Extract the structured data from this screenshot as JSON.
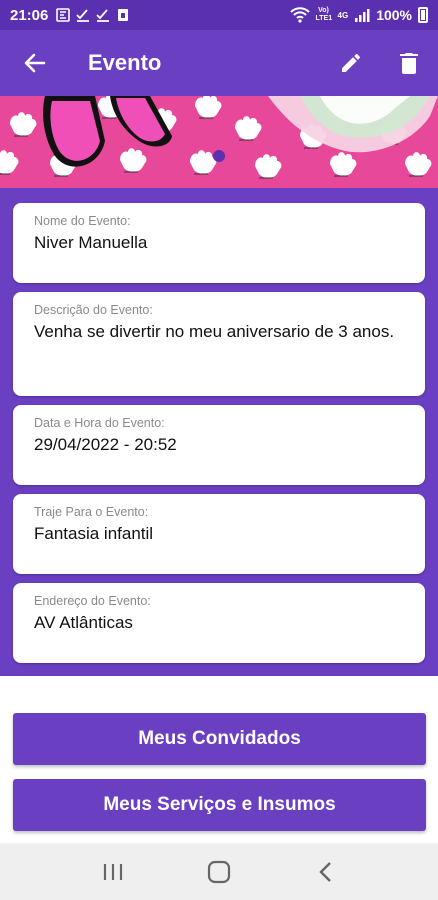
{
  "status_bar": {
    "time": "21:06",
    "battery_text": "100%",
    "network_text": "Vo) LTE1",
    "signal_text": "4G"
  },
  "app_bar": {
    "title": "Evento",
    "back_icon": "arrow-left-icon",
    "edit_icon": "pencil-icon",
    "delete_icon": "trash-icon"
  },
  "event": {
    "fields": [
      {
        "label": "Nome do Evento:",
        "value": "Niver Manuella"
      },
      {
        "label": "Descrição do Evento:",
        "value": "Venha se divertir no meu aniversario de 3 anos."
      },
      {
        "label": "Data e Hora do Evento:",
        "value": "29/04/2022 - 20:52"
      },
      {
        "label": "Traje Para o Evento:",
        "value": "Fantasia infantil"
      },
      {
        "label": "Endereço do Evento:",
        "value": "AV Atlânticas"
      }
    ]
  },
  "actions": {
    "guests_label": "Meus Convidados",
    "services_label": "Meus Serviços e Insumos"
  },
  "nav_bar": {
    "recents_icon": "recents-icon",
    "home_icon": "home-icon",
    "back_icon": "back-chevron-icon"
  },
  "colors": {
    "primary": "#6a3fc1",
    "status_bar": "#5a2fb0",
    "banner_pink": "#e7489a"
  }
}
